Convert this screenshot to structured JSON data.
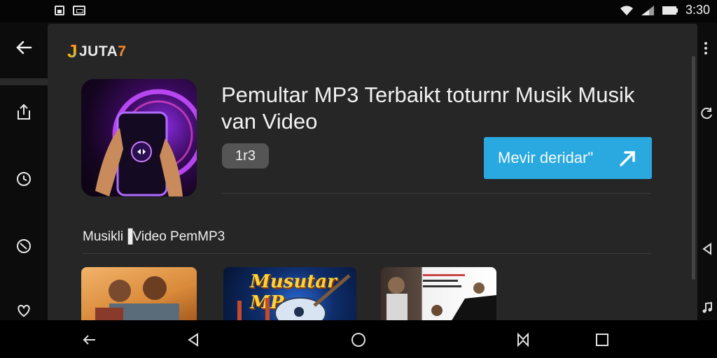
{
  "status_bar": {
    "time": "3:30",
    "icons": [
      "notification-image-icon",
      "notification-app-icon",
      "wifi-icon",
      "signal-icon",
      "battery-icon"
    ]
  },
  "left_rail": {
    "icons": [
      "back-arrow-icon",
      "share-icon",
      "clock-icon",
      "tag-icon",
      "heart-icon"
    ]
  },
  "right_rail": {
    "icons": [
      "more-vert-icon",
      "refresh-icon",
      "previous-icon",
      "music-note-icon"
    ]
  },
  "app": {
    "brand": {
      "j": "J",
      "main": "JUTA",
      "accent": "7"
    },
    "title": "Pemultar MP3 Terbaikt toturnr Musik Musik van Video",
    "badge": "1r3",
    "cta_label": "Mevir deridar\"",
    "section_title": "Musikli▐Video PemMP3",
    "thumbnails": [
      {
        "name": "thumbnail-people",
        "text": ""
      },
      {
        "name": "thumbnail-guitar",
        "text": "Musutar MP"
      },
      {
        "name": "thumbnail-artist",
        "text": ""
      }
    ]
  },
  "nav_bar": {
    "icons": [
      "back-icon",
      "triangle-back-icon",
      "home-icon",
      "bookmark-icon",
      "recents-icon"
    ]
  },
  "colors": {
    "card_bg": "#262626",
    "cta_bg": "#2aa9e0",
    "badge_bg": "#555555"
  }
}
